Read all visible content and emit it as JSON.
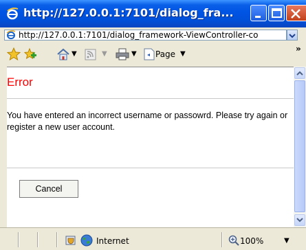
{
  "window": {
    "title": "http://127.0.0.1:7101/dialog_fra..."
  },
  "address_bar": {
    "url": "http://127.0.0.1:7101/dialog_framework-ViewController-co"
  },
  "toolbar": {
    "page_label": "Page",
    "more": "»"
  },
  "dialog": {
    "title": "Error",
    "message": "You have entered an incorrect username or passowrd. Please try again or register a new user account.",
    "cancel_label": "Cancel"
  },
  "status_bar": {
    "zone": "Internet",
    "zoom": "100%"
  },
  "colors": {
    "error_title": "#ff0000",
    "titlebar": "#0054e3"
  }
}
